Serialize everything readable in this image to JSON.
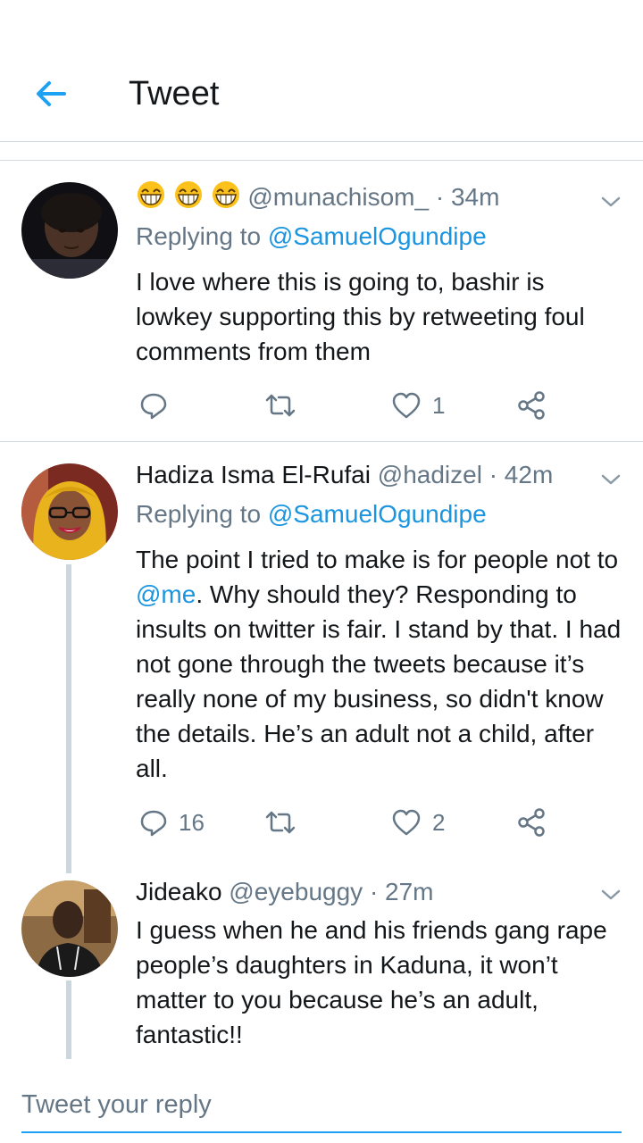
{
  "header": {
    "title": "Tweet",
    "back_icon": "arrow-left-icon",
    "accent": "#1da1f2"
  },
  "tweets": [
    {
      "emoji_icons": [
        "grinning-emoji-icon",
        "grinning-emoji-icon",
        "grinning-emoji-icon"
      ],
      "name": "",
      "handle": "@munachisom_",
      "time": "· 34m",
      "replying_label": "Replying to",
      "replying_handle": "@SamuelOgundipe",
      "text": "I love where this is going to, bashir is lowkey supporting this by retweeting foul comments from them",
      "replies": "",
      "retweets": "",
      "likes": "1"
    },
    {
      "name": "Hadiza Isma El-Rufai",
      "handle": "@hadizel",
      "time": "· 42m",
      "replying_label": "Replying to",
      "replying_handle": "@SamuelOgundipe",
      "text_before": "The point I tried to make is for people not to ",
      "text_mention": "@me",
      "text_after": ".  Why should they? Responding to insults on twitter is fair. I stand by that. I had not gone through the tweets because it’s really none of my business, so didn't know the details. He’s an adult not a child, after all.",
      "replies": "16",
      "retweets": "",
      "likes": "2"
    },
    {
      "name": "Jideako",
      "handle": "@eyebuggy",
      "time": "· 27m",
      "text": "I guess when he and his friends gang rape people’s daughters in Kaduna, it won’t matter to you because he’s an adult, fantastic!!"
    }
  ],
  "composer": {
    "placeholder": "Tweet your reply"
  }
}
